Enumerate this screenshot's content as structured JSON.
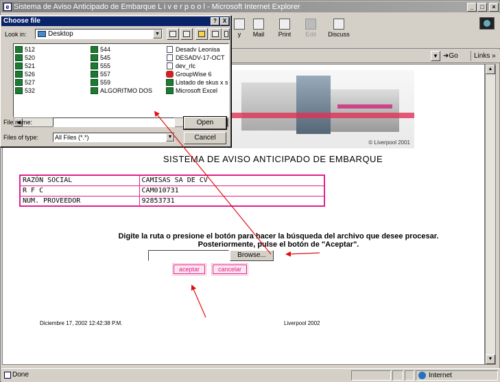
{
  "window": {
    "title": "Sistema de Aviso Anticipado de Embarque   L i v e r p o o l - Microsoft Internet Explorer"
  },
  "toolbar": {
    "items": [
      {
        "label": "y",
        "icon": "history-icon"
      },
      {
        "label": "Mail",
        "icon": "mail-icon"
      },
      {
        "label": "Print",
        "icon": "print-icon"
      },
      {
        "label": "Edit",
        "icon": "edit-icon"
      },
      {
        "label": "Discuss",
        "icon": "discuss-icon"
      }
    ]
  },
  "addressbar": {
    "go_label": "Go",
    "links_label": "Links »"
  },
  "banner": {
    "credit": "© Liverpool 2001"
  },
  "page": {
    "title": "SISTEMA DE AVISO ANTICIPADO DE EMBARQUE",
    "info_rows": [
      {
        "label": "RAZÓN SOCIAL",
        "value": "CAMISAS SA DE CV"
      },
      {
        "label": "R F C",
        "value": "CAM010731"
      },
      {
        "label": "NUM. PROVEEDOR",
        "value": "92853731"
      }
    ],
    "instruction_line1": "Digite la ruta o presione el botón para hacer la búsqueda del archivo que desee procesar.",
    "instruction_line2": "Posteriormente, pulse el botón de \"Aceptar\".",
    "file_value": "",
    "browse_label": "Browse...",
    "accept_label": "aceptar",
    "cancel_label": "cancelar",
    "footer_date": "Diciembre 17, 2002 12:42:38 P.M.",
    "footer_brand": "Liverpool 2002"
  },
  "status": {
    "text": "Done",
    "zone": "Internet"
  },
  "dialog": {
    "title": "Choose file",
    "help_label": "?",
    "close_label": "X",
    "lookin_label": "Look in:",
    "lookin_value": "Desktop",
    "files_col1": [
      "512",
      "520",
      "521",
      "526",
      "527",
      "532"
    ],
    "files_col2": [
      "544",
      "545",
      "555",
      "557",
      "559",
      "ALGORITMO DOS"
    ],
    "files_col3": [
      {
        "name": "Desadv Leonisa",
        "type": "doc"
      },
      {
        "name": "DESADV-17-OCT",
        "type": "doc"
      },
      {
        "name": "dev_rlc",
        "type": "doc"
      },
      {
        "name": "GroupWise 6",
        "type": "gw"
      },
      {
        "name": "Listado de skus x sec",
        "type": "xls"
      },
      {
        "name": "Microsoft Excel",
        "type": "xls"
      }
    ],
    "filename_label": "File name:",
    "filename_value": "",
    "filetype_label": "Files of type:",
    "filetype_value": "All Files (*.*)",
    "open_label": "Open",
    "cancel_label": "Cancel"
  }
}
